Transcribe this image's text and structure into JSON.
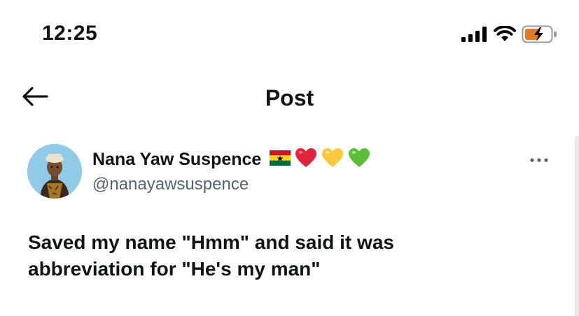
{
  "status_bar": {
    "time": "12:25",
    "icons": [
      "cellular-signal-icon",
      "wifi-icon",
      "battery-charging-icon"
    ],
    "battery_color": "#e07a29"
  },
  "header": {
    "back_icon": "arrow-left-icon",
    "title": "Post"
  },
  "post": {
    "author": {
      "display_name": "Nana Yaw Suspence",
      "name_emojis": [
        "ghana-flag",
        "❤️",
        "💛",
        "💚"
      ],
      "handle": "@nanayawsuspence"
    },
    "more_icon": "more-horizontal-icon",
    "text": "Saved my name \"Hmm\" and said it was\nabbreviation for \"He's my man\""
  },
  "colors": {
    "text_primary": "#0f1419",
    "text_secondary": "#536471",
    "background": "#ffffff"
  }
}
